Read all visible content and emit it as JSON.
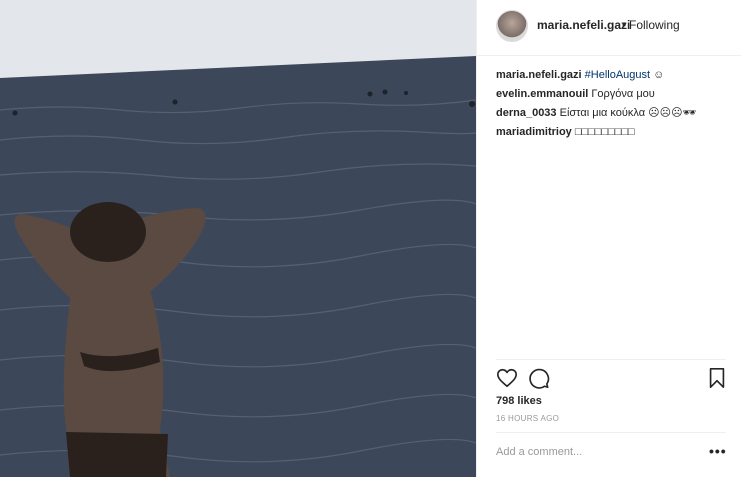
{
  "post": {
    "username": "maria.nefeli.gazi",
    "separator": "•",
    "follow_status": "Following",
    "comments": [
      {
        "user": "maria.nefeli.gazi",
        "text": "#HelloAugust",
        "suffix": "☺"
      },
      {
        "user": "evelin.emmanouil",
        "text": "Γοργόνα μου",
        "suffix": ""
      },
      {
        "user": "derna_0033",
        "text": "Είσται μια κούκλα ☹☹☹🕶",
        "suffix": ""
      },
      {
        "user": "mariadimitrioy",
        "text": "□□□□□□□□□",
        "suffix": ""
      }
    ],
    "likes": "798 likes",
    "timestamp": "16 HOURS AGO",
    "add_comment_placeholder": "Add a comment...",
    "more_label": "•••",
    "icons": {
      "like": "heart-icon",
      "comment": "comment-icon",
      "save": "bookmark-icon",
      "more": "more-icon"
    }
  }
}
